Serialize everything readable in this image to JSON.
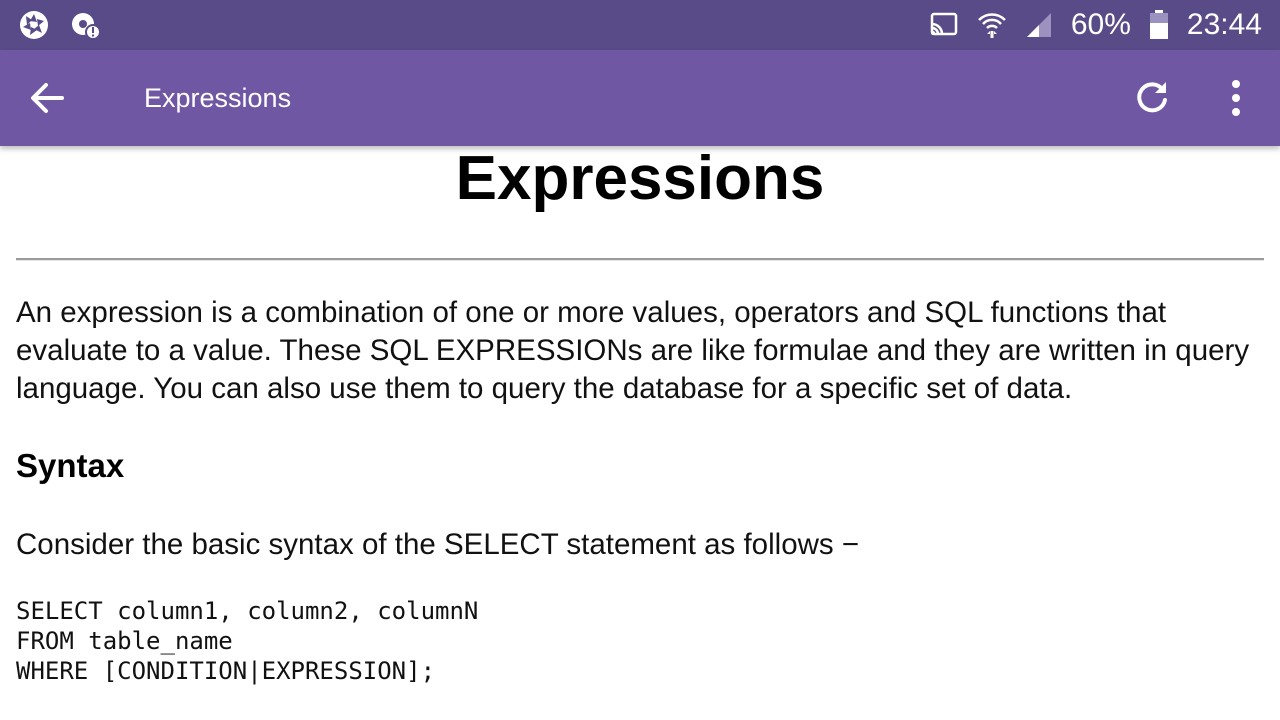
{
  "status_bar": {
    "battery_percent": "60%",
    "time": "23:44",
    "icons": [
      "aperture-icon",
      "location-alert-icon",
      "cast-icon",
      "wifi-icon",
      "signal-icon",
      "battery-icon"
    ]
  },
  "app_bar": {
    "title": "Expressions",
    "color": "#7057a3",
    "status_color": "#584b87"
  },
  "page": {
    "title": "Expressions",
    "intro": "An expression is a combination of one or more values, operators and SQL functions that evaluate to a value. These SQL EXPRESSIONs are like formulae and they are written in query language. You can also use them to query the database for a specific set of data.",
    "syntax_heading": "Syntax",
    "syntax_text": "Consider the basic syntax of the SELECT statement as follows −",
    "code_lines": [
      "SELECT column1, column2, columnN",
      "FROM table_name",
      "WHERE [CONDITION|EXPRESSION];"
    ]
  }
}
